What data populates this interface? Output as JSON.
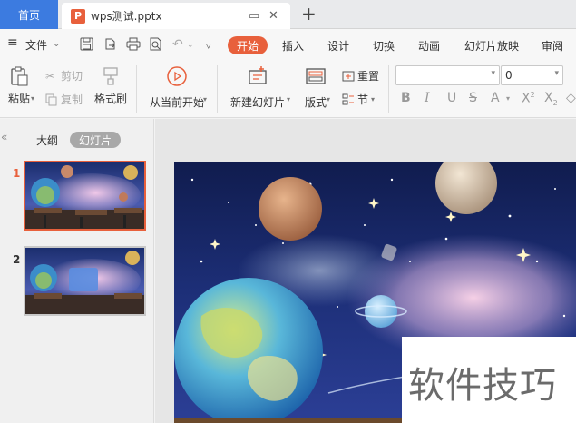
{
  "tabs": {
    "home": "首页",
    "doc_title": "wps测试.pptx",
    "new_tab": "+"
  },
  "menu": {
    "file": "文件",
    "items": [
      "开始",
      "插入",
      "设计",
      "切换",
      "动画",
      "幻灯片放映",
      "审阅"
    ]
  },
  "ribbon": {
    "paste": "粘贴",
    "cut": "剪切",
    "copy": "复制",
    "format_painter": "格式刷",
    "play_from_current": "从当前开始",
    "new_slide": "新建幻灯片",
    "layout": "版式",
    "reset": "重置",
    "section": "节",
    "font_name": "",
    "font_size": "0"
  },
  "sidebar": {
    "outline_tab": "大纲",
    "slides_tab": "幻灯片",
    "slides": [
      {
        "num": "1"
      },
      {
        "num": "2"
      }
    ]
  },
  "watermark": "软件技巧",
  "colors": {
    "accent": "#e8603c",
    "home_tab": "#3c7be0",
    "thumb_selected": "#e8603c"
  }
}
